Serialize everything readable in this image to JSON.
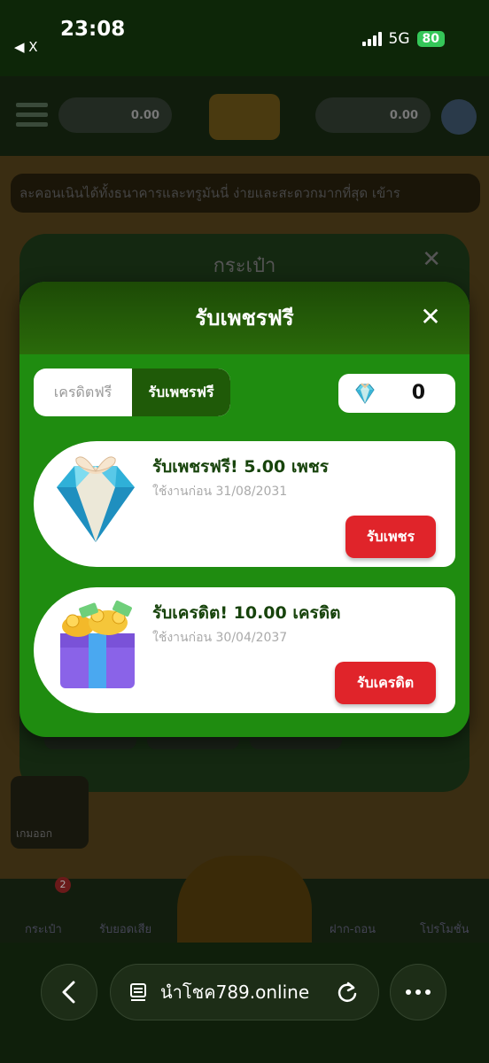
{
  "status_bar": {
    "time": "23:08",
    "back_label": "◀ X",
    "network": "5G",
    "battery": "80"
  },
  "background": {
    "header": {
      "left_balance": "0.00",
      "right_balance": "0.00"
    },
    "marquee": "ละคอนเนินได้ทั้งธนาคารและทรูมันนี่ ง่ายและสะดวกมากที่สุด เข้าร",
    "wallet_modal_title": "กระเป๋า",
    "tile_label": "เกมออก",
    "nav": {
      "wallet": "กระเป๋า",
      "wallet_badge": "2",
      "leaderboard": "รับยอดเสีย",
      "deposit": "ฝาก-ถอน",
      "promo": "โปรโมชั่น"
    }
  },
  "modal": {
    "title": "รับเพชรฟรี",
    "tabs": [
      {
        "label": "เครดิตฟรี",
        "active": false
      },
      {
        "label": "รับเพชรฟรี",
        "active": true
      }
    ],
    "diamond_count": "0",
    "cards": [
      {
        "title": "รับเพชรฟรี! 5.00 เพชร",
        "subtitle": "ใช้งานก่อน 31/08/2031",
        "button": "รับเพชร",
        "icon": "diamond-gift-icon"
      },
      {
        "title": "รับเครดิต! 10.00 เครดิต",
        "subtitle": "ใช้งานก่อน 30/04/2037",
        "button": "รับเครดิต",
        "icon": "gift-box-icon"
      }
    ]
  },
  "browser": {
    "url": "นำโชค789.online"
  },
  "colors": {
    "accent_green": "#1f8c10",
    "header_green": "#1d4a06",
    "button_red": "#e0242a",
    "title_green": "#17430b"
  }
}
